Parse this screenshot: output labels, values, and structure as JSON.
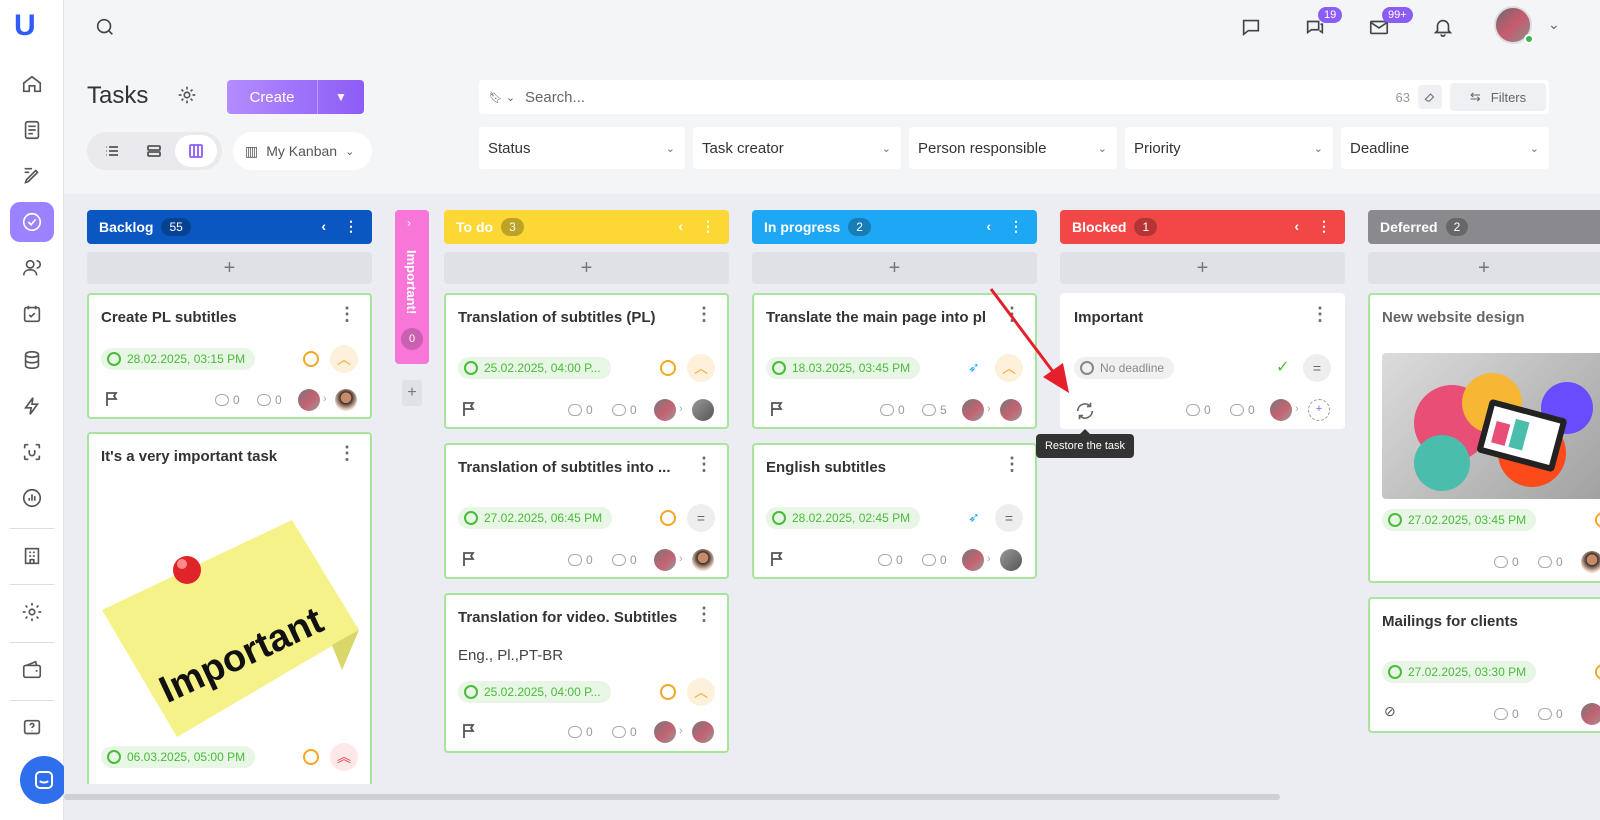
{
  "page": {
    "title": "Tasks"
  },
  "toolbar": {
    "create_label": "Create",
    "kanban_label": "My Kanban"
  },
  "search": {
    "placeholder": "Search...",
    "count": "63",
    "filters_label": "Filters"
  },
  "filters": [
    "Status",
    "Task creator",
    "Person responsible",
    "Priority",
    "Deadline"
  ],
  "header_badges": {
    "chats": "19",
    "mail": "99+"
  },
  "colors": {
    "backlog": "#0a57c2",
    "todo": "#fdd835",
    "inprogress": "#1ea7f5",
    "blocked": "#f24747",
    "deferred": "#8a8a8e",
    "important": "#f776d8",
    "accent": "#8b5cf6"
  },
  "columns": {
    "backlog": {
      "name": "Backlog",
      "count": "55"
    },
    "todo": {
      "name": "To do",
      "count": "3"
    },
    "inprogress": {
      "name": "In progress",
      "count": "2"
    },
    "blocked": {
      "name": "Blocked",
      "count": "1"
    },
    "deferred": {
      "name": "Deferred",
      "count": "2"
    }
  },
  "important_lane": {
    "name": "Important!",
    "count": "0"
  },
  "cards": {
    "b1": {
      "title": "Create PL subtitles",
      "date": "28.02.2025, 03:15 PM",
      "subtasks": "0",
      "comments": "0"
    },
    "b2": {
      "title": "It's a very important task",
      "sticky_text": "Important",
      "date": "06.03.2025, 05:00 PM"
    },
    "t1": {
      "title": "Translation of subtitles (PL)",
      "date": "25.02.2025, 04:00 P...",
      "subtasks": "0",
      "comments": "0"
    },
    "t2": {
      "title": "Translation of subtitles into ...",
      "date": "27.02.2025, 06:45 PM",
      "subtasks": "0",
      "comments": "0"
    },
    "t3": {
      "title": "Translation for video. Subtitles",
      "subtitle": "Eng., Pl.,PT-BR",
      "date": "25.02.2025, 04:00 P...",
      "subtasks": "0",
      "comments": "0"
    },
    "p1": {
      "title": "Translate the main page into pl",
      "date": "18.03.2025, 03:45 PM",
      "subtasks": "0",
      "comments": "5"
    },
    "p2": {
      "title": "English subtitles",
      "date": "28.02.2025, 02:45 PM",
      "subtasks": "0",
      "comments": "0"
    },
    "k1": {
      "title": "Important",
      "date": "No deadline",
      "subtasks": "0",
      "comments": "0"
    },
    "d1": {
      "title": "New website design",
      "date": "27.02.2025, 03:45 PM",
      "subtasks": "0",
      "comments": "0"
    },
    "d2": {
      "title": "Mailings for clients",
      "date": "27.02.2025, 03:30 PM",
      "subtasks": "0",
      "comments": "0"
    }
  },
  "tooltip": {
    "text": "Restore the task"
  }
}
